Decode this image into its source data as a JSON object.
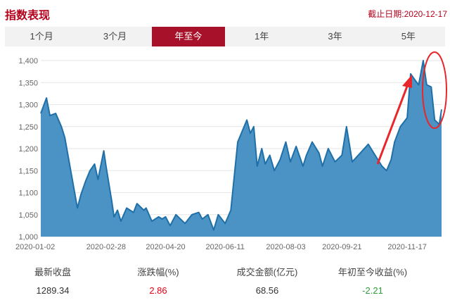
{
  "header": {
    "title": "指数表现",
    "as_of": "截止日期:2020-12-17"
  },
  "tabs": [
    {
      "label": "1个月",
      "active": false
    },
    {
      "label": "3个月",
      "active": false
    },
    {
      "label": "年至今",
      "active": true
    },
    {
      "label": "1年",
      "active": false
    },
    {
      "label": "3年",
      "active": false
    },
    {
      "label": "5年",
      "active": false
    }
  ],
  "stats": [
    {
      "label": "最新收盘",
      "value": "1289.34"
    },
    {
      "label": "涨跌幅(%)",
      "value": "2.86"
    },
    {
      "label": "成交金额(亿元)",
      "value": "68.56"
    },
    {
      "label": "年初至今收益(%)",
      "value": "-2.21"
    }
  ],
  "colors": {
    "brand": "#a8112a",
    "area_fill": "#4a93c4",
    "area_line": "#1f6fa8",
    "annotation": "#e8262b",
    "up": "#e60012",
    "down": "#2e9b35"
  },
  "chart_data": {
    "type": "area",
    "ylim": [
      1000,
      1400
    ],
    "yticks": [
      "1,000",
      "1,050",
      "1,100",
      "1,150",
      "1,200",
      "1,250",
      "1,300",
      "1,350",
      "1,400"
    ],
    "xticks": [
      "2020-01-02",
      "2020-02-28",
      "2020-04-20",
      "2020-06-11",
      "2020-08-03",
      "2020-09-21",
      "2020-11-17"
    ],
    "x": [
      "2020-01-02",
      "2020-01-07",
      "2020-01-10",
      "2020-01-15",
      "2020-01-20",
      "2020-01-23",
      "2020-02-03",
      "2020-02-06",
      "2020-02-10",
      "2020-02-14",
      "2020-02-18",
      "2020-02-21",
      "2020-02-26",
      "2020-02-28",
      "2020-03-04",
      "2020-03-06",
      "2020-03-09",
      "2020-03-12",
      "2020-03-17",
      "2020-03-23",
      "2020-03-26",
      "2020-04-01",
      "2020-04-03",
      "2020-04-08",
      "2020-04-14",
      "2020-04-17",
      "2020-04-20",
      "2020-04-24",
      "2020-04-29",
      "2020-05-07",
      "2020-05-13",
      "2020-05-19",
      "2020-05-22",
      "2020-05-27",
      "2020-06-01",
      "2020-06-05",
      "2020-06-11",
      "2020-06-16",
      "2020-06-22",
      "2020-06-30",
      "2020-07-03",
      "2020-07-06",
      "2020-07-09",
      "2020-07-13",
      "2020-07-16",
      "2020-07-20",
      "2020-07-24",
      "2020-07-29",
      "2020-08-03",
      "2020-08-07",
      "2020-08-12",
      "2020-08-18",
      "2020-08-21",
      "2020-08-26",
      "2020-09-01",
      "2020-09-04",
      "2020-09-09",
      "2020-09-15",
      "2020-09-21",
      "2020-09-25",
      "2020-09-30",
      "2020-10-14",
      "2020-10-20",
      "2020-10-26",
      "2020-10-30",
      "2020-11-03",
      "2020-11-06",
      "2020-11-11",
      "2020-11-17",
      "2020-11-20",
      "2020-11-24",
      "2020-11-27",
      "2020-12-01",
      "2020-12-04",
      "2020-12-08",
      "2020-12-11",
      "2020-12-15",
      "2020-12-17"
    ],
    "values": [
      1280,
      1315,
      1275,
      1280,
      1250,
      1225,
      1065,
      1095,
      1125,
      1150,
      1165,
      1130,
      1195,
      1160,
      1080,
      1045,
      1060,
      1035,
      1065,
      1055,
      1075,
      1060,
      1065,
      1035,
      1045,
      1040,
      1045,
      1025,
      1050,
      1030,
      1050,
      1055,
      1040,
      1050,
      1015,
      1050,
      1030,
      1060,
      1215,
      1265,
      1235,
      1250,
      1160,
      1200,
      1165,
      1185,
      1150,
      1175,
      1215,
      1170,
      1205,
      1160,
      1185,
      1215,
      1190,
      1160,
      1200,
      1170,
      1185,
      1250,
      1170,
      1210,
      1185,
      1160,
      1150,
      1175,
      1215,
      1250,
      1270,
      1370,
      1355,
      1345,
      1400,
      1345,
      1340,
      1265,
      1255,
      1289
    ]
  }
}
